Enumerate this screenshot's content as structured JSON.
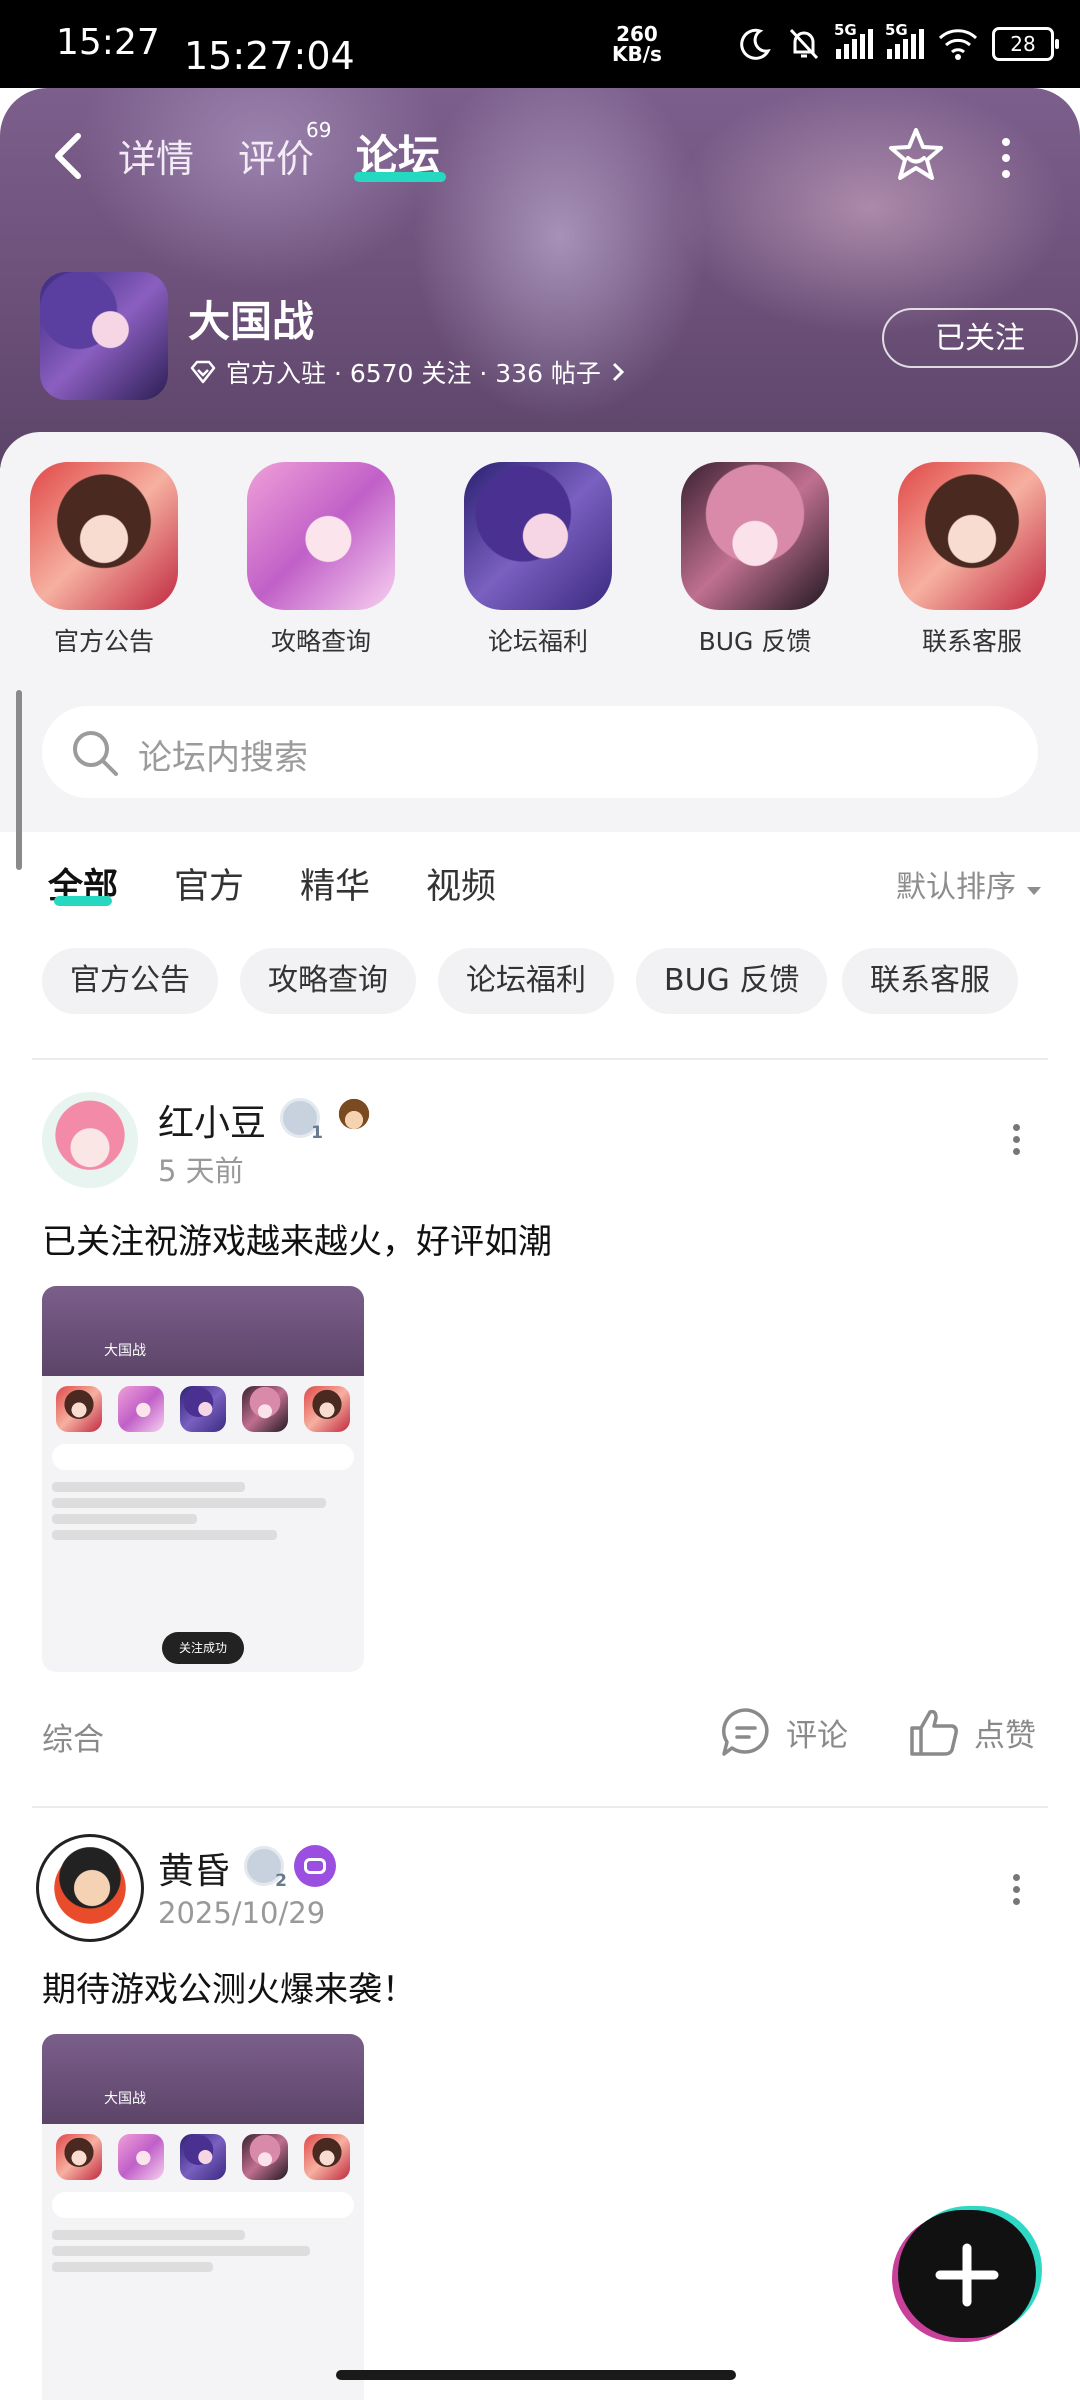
{
  "status_bar": {
    "time": "15:27",
    "clock": "15:27:04",
    "net_speed_value": "260",
    "net_speed_unit": "KB/s",
    "signal_1": "5G",
    "signal_2": "5G",
    "battery": "28"
  },
  "header": {
    "tabs": [
      "详情",
      "评价",
      "论坛"
    ],
    "review_count": "69",
    "active_tab": "论坛"
  },
  "game": {
    "title": "大国战",
    "meta": "官方入驻 · 6570 关注 · 336 帖子",
    "follow_label": "已关注"
  },
  "boards": [
    {
      "label": "官方公告"
    },
    {
      "label": "攻略查询"
    },
    {
      "label": "论坛福利"
    },
    {
      "label": "BUG 反馈"
    },
    {
      "label": "联系客服"
    }
  ],
  "search": {
    "placeholder": "论坛内搜索"
  },
  "filters": {
    "tabs": [
      "全部",
      "官方",
      "精华",
      "视频"
    ],
    "sort_label": "默认排序",
    "chips": [
      "官方公告",
      "攻略查询",
      "论坛福利",
      "BUG 反馈",
      "联系客服"
    ]
  },
  "posts": [
    {
      "author": "红小豆",
      "level": "1",
      "time": "5 天前",
      "text": "已关注祝游戏越来越火，好评如潮",
      "screenshot": {
        "title": "大国战",
        "toast": "关注成功"
      },
      "category": "综合",
      "comment_label": "评论",
      "like_label": "点赞"
    },
    {
      "author": "黄昏",
      "level": "2",
      "time": "2025/10/29",
      "text": "期待游戏公测火爆来袭！",
      "screenshot": {
        "title": "大国战"
      }
    }
  ],
  "icons": {
    "back": "chevron-left-icon",
    "favorite": "star-icon",
    "more": "more-vertical-icon",
    "search": "search-icon",
    "comment": "comment-icon",
    "like": "thumbs-up-icon",
    "create": "plus-icon"
  },
  "colors": {
    "accent": "#27d8c1",
    "header_bg": "#6c5079"
  }
}
